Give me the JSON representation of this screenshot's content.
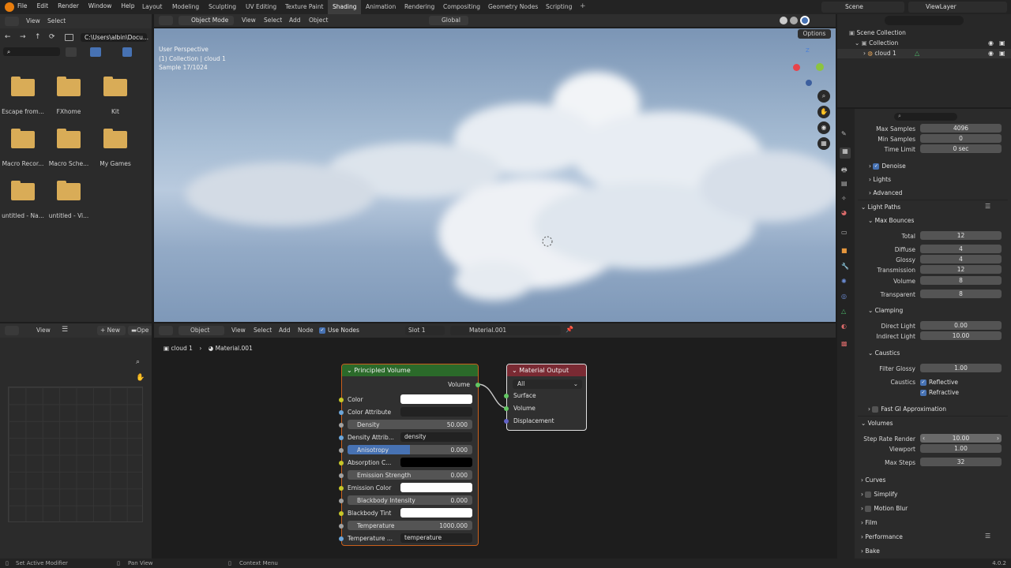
{
  "topbar": {
    "menus": [
      "File",
      "Edit",
      "Render",
      "Window",
      "Help"
    ],
    "workspaces": [
      "Layout",
      "Modeling",
      "Sculpting",
      "UV Editing",
      "Texture Paint",
      "Shading",
      "Animation",
      "Rendering",
      "Compositing",
      "Geometry Nodes",
      "Scripting"
    ],
    "active_workspace": "Shading",
    "scene": "Scene",
    "view_layer": "ViewLayer"
  },
  "file_browser": {
    "header_menus": [
      "View",
      "Select"
    ],
    "path": "C:\\Users\\albin\\Docu...",
    "items": [
      "Escape from...",
      "FXhome",
      "Kit",
      "Macro Recor...",
      "Macro Sche...",
      "My Games",
      "untitled - Na...",
      "untitled - Vi..."
    ]
  },
  "viewport": {
    "mode": "Object Mode",
    "menus": [
      "View",
      "Select",
      "Add",
      "Object"
    ],
    "orientation": "Global",
    "options_label": "Options",
    "info": [
      "User Perspective",
      "(1) Collection | cloud 1",
      "Sample 17/1024"
    ]
  },
  "outliner": {
    "root": "Scene Collection",
    "collection": "Collection",
    "object": "cloud 1"
  },
  "image_editor": {
    "view_label": "View",
    "new_label": "New",
    "open_label": "Ope"
  },
  "node_editor": {
    "type_label": "Object",
    "menus": [
      "View",
      "Select",
      "Add",
      "Node"
    ],
    "use_nodes_label": "Use Nodes",
    "slot": "Slot 1",
    "material": "Material.001",
    "breadcrumb_obj": "cloud 1",
    "breadcrumb_mat": "Material.001"
  },
  "principled": {
    "title": "Principled Volume",
    "out_label": "Volume",
    "rows": [
      {
        "name": "Color"
      },
      {
        "name": "Color Attribute"
      },
      {
        "name": "Density",
        "value": "50.000"
      },
      {
        "name": "Density Attrib...",
        "text": "density"
      },
      {
        "name": "Anisotropy",
        "value": "0.000"
      },
      {
        "name": "Absorption C..."
      },
      {
        "name": "Emission Strength",
        "value": "0.000"
      },
      {
        "name": "Emission Color"
      },
      {
        "name": "Blackbody Intensity",
        "value": "0.000"
      },
      {
        "name": "Blackbody Tint"
      },
      {
        "name": "Temperature",
        "value": "1000.000"
      },
      {
        "name": "Temperature ...",
        "text": "temperature"
      }
    ]
  },
  "material_output": {
    "title": "Material Output",
    "target": "All",
    "inputs": [
      "Surface",
      "Volume",
      "Displacement"
    ]
  },
  "properties": {
    "max_samples_label": "Max Samples",
    "max_samples": "4096",
    "min_samples_label": "Min Samples",
    "min_samples": "0",
    "time_limit_label": "Time Limit",
    "time_limit": "0 sec",
    "denoise": "Denoise",
    "lights": "Lights",
    "advanced": "Advanced",
    "light_paths": "Light Paths",
    "max_bounces": "Max Bounces",
    "bounces": [
      {
        "label": "Total",
        "value": "12"
      },
      {
        "label": "Diffuse",
        "value": "4"
      },
      {
        "label": "Glossy",
        "value": "4"
      },
      {
        "label": "Transmission",
        "value": "12"
      },
      {
        "label": "Volume",
        "value": "8"
      },
      {
        "label": "Transparent",
        "value": "8"
      }
    ],
    "clamping": "Clamping",
    "direct_light_label": "Direct Light",
    "direct_light": "0.00",
    "indirect_light_label": "Indirect Light",
    "indirect_light": "10.00",
    "caustics": "Caustics",
    "filter_glossy_label": "Filter Glossy",
    "filter_glossy": "1.00",
    "caustics_label": "Caustics",
    "reflective": "Reflective",
    "refractive": "Refractive",
    "fast_gi": "Fast GI Approximation",
    "volumes": "Volumes",
    "step_rate_label": "Step Rate Render",
    "step_rate": "10.00",
    "viewport_label": "Viewport",
    "viewport_value": "1.00",
    "max_steps_label": "Max Steps",
    "max_steps": "32",
    "curves": "Curves",
    "simplify": "Simplify",
    "motion_blur": "Motion Blur",
    "film": "Film",
    "performance": "Performance",
    "bake": "Bake"
  },
  "statusbar": {
    "left": "Set Active Modifier",
    "mid": "Pan View",
    "right": "Context Menu",
    "version": "4.0.2"
  }
}
